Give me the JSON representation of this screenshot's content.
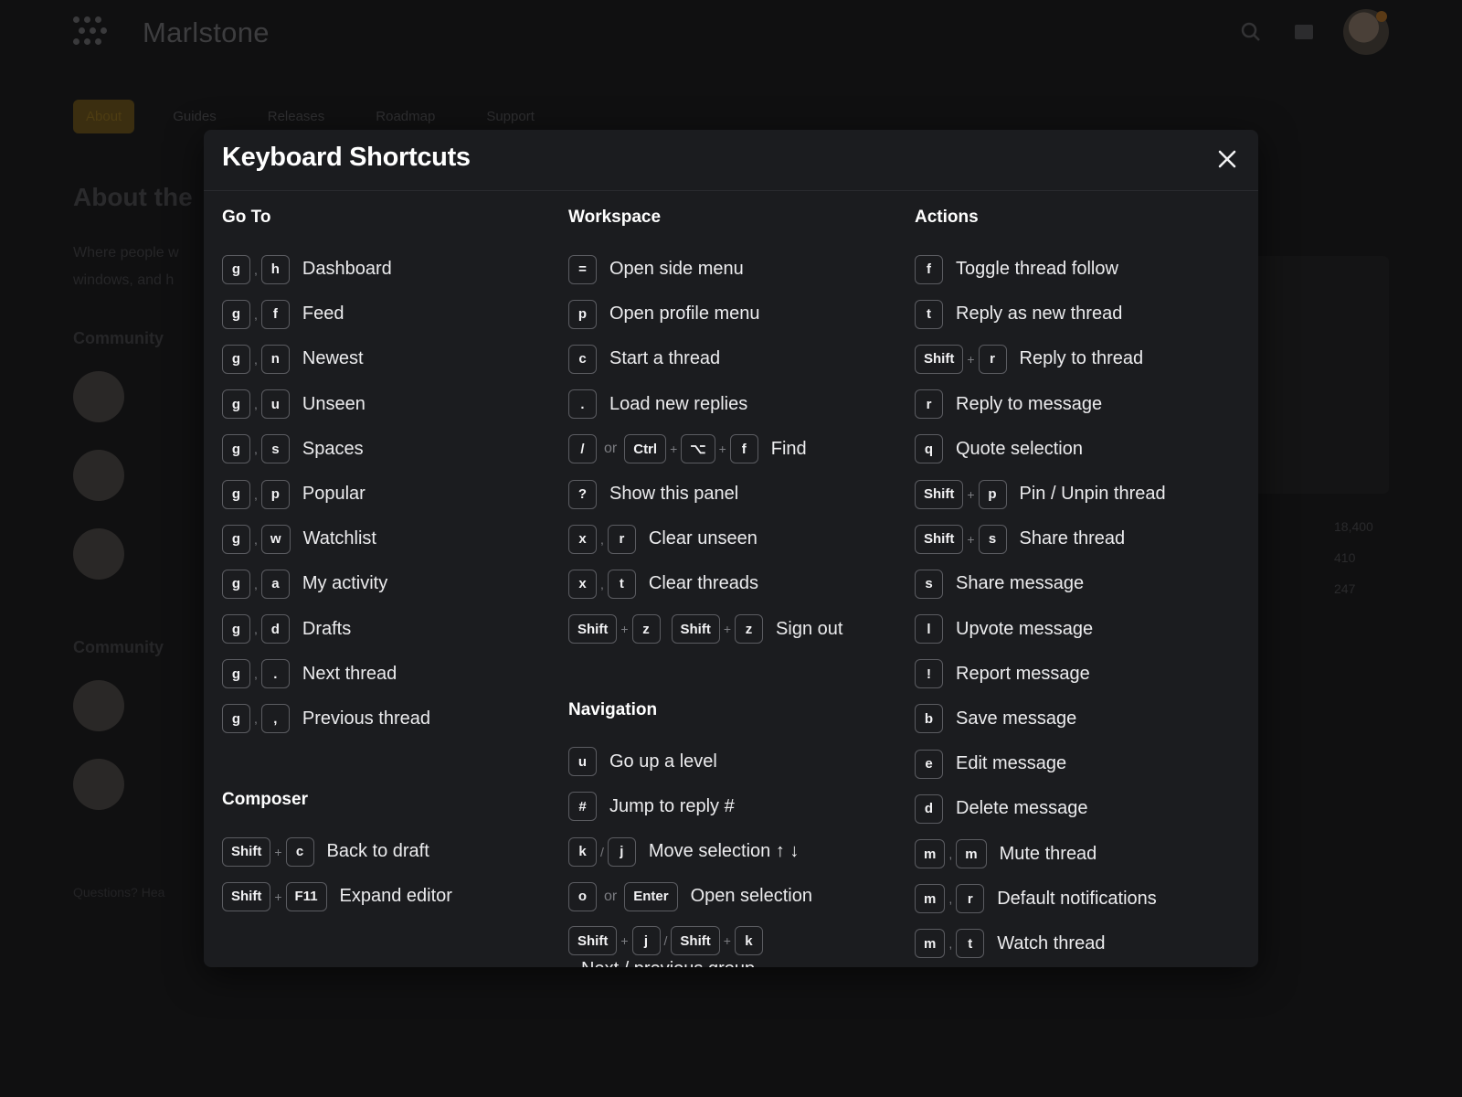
{
  "app": {
    "brand": "Marlstone",
    "accent": "#f0a91e"
  },
  "header_icons": [
    "search-icon",
    "grid-icon"
  ],
  "background": {
    "tabs": [
      "About",
      "Guides",
      "Releases",
      "Roadmap",
      "Support"
    ],
    "title": "About the",
    "description": "Where people w windows, and h",
    "sections": [
      "Community",
      "Community"
    ],
    "stats": [
      "18,400",
      "410",
      "247"
    ],
    "footer": "Questions? Hea"
  },
  "modal": {
    "title": "Keyboard Shortcuts",
    "close_icon": "close-icon",
    "columns": [
      {
        "sections": [
          {
            "title": "Go To",
            "shortcuts": [
              {
                "keys": [
                  [
                    "g"
                  ],
                  [
                    "h"
                  ]
                ],
                "joiners": [
                  ","
                ],
                "description": "Dashboard"
              },
              {
                "keys": [
                  [
                    "g"
                  ],
                  [
                    "f"
                  ]
                ],
                "joiners": [
                  ","
                ],
                "description": "Feed"
              },
              {
                "keys": [
                  [
                    "g"
                  ],
                  [
                    "n"
                  ]
                ],
                "joiners": [
                  ","
                ],
                "description": "Newest"
              },
              {
                "keys": [
                  [
                    "g"
                  ],
                  [
                    "u"
                  ]
                ],
                "joiners": [
                  ","
                ],
                "description": "Unseen"
              },
              {
                "keys": [
                  [
                    "g"
                  ],
                  [
                    "s"
                  ]
                ],
                "joiners": [
                  ","
                ],
                "description": "Spaces"
              },
              {
                "keys": [
                  [
                    "g"
                  ],
                  [
                    "p"
                  ]
                ],
                "joiners": [
                  ","
                ],
                "description": "Popular"
              },
              {
                "keys": [
                  [
                    "g"
                  ],
                  [
                    "w"
                  ]
                ],
                "joiners": [
                  ","
                ],
                "description": "Watchlist"
              },
              {
                "keys": [
                  [
                    "g"
                  ],
                  [
                    "a"
                  ]
                ],
                "joiners": [
                  ","
                ],
                "description": "My activity"
              },
              {
                "keys": [
                  [
                    "g"
                  ],
                  [
                    "d"
                  ]
                ],
                "joiners": [
                  ","
                ],
                "description": "Drafts"
              },
              {
                "keys": [
                  [
                    "g"
                  ],
                  [
                    "."
                  ]
                ],
                "joiners": [
                  ","
                ],
                "description": "Next thread"
              },
              {
                "keys": [
                  [
                    "g"
                  ],
                  [
                    ","
                  ]
                ],
                "joiners": [
                  ","
                ],
                "description": "Previous thread"
              }
            ]
          },
          {
            "title": "Composer",
            "shortcuts": [
              {
                "keys": [
                  [
                    "Shift",
                    "c"
                  ]
                ],
                "joiners": [],
                "description": "Back to draft"
              },
              {
                "keys": [
                  [
                    "Shift",
                    "F11"
                  ]
                ],
                "joiners": [],
                "description": "Expand editor"
              }
            ]
          }
        ]
      },
      {
        "sections": [
          {
            "title": "Workspace",
            "shortcuts": [
              {
                "keys": [
                  [
                    "="
                  ]
                ],
                "joiners": [],
                "description": "Open side menu"
              },
              {
                "keys": [
                  [
                    "p"
                  ]
                ],
                "joiners": [],
                "description": "Open profile menu"
              },
              {
                "keys": [
                  [
                    "c"
                  ]
                ],
                "joiners": [],
                "description": "Start a thread"
              },
              {
                "keys": [
                  [
                    "."
                  ]
                ],
                "joiners": [],
                "description": "Load new replies"
              },
              {
                "keys": [
                  [
                    "/"
                  ],
                  [
                    "Ctrl",
                    "⌥",
                    "f"
                  ]
                ],
                "joiners": [
                  "or"
                ],
                "description": "Find"
              },
              {
                "keys": [
                  [
                    "?"
                  ]
                ],
                "joiners": [],
                "description": "Show this panel"
              },
              {
                "keys": [
                  [
                    "x"
                  ],
                  [
                    "r"
                  ]
                ],
                "joiners": [
                  ","
                ],
                "description": "Clear unseen"
              },
              {
                "keys": [
                  [
                    "x"
                  ],
                  [
                    "t"
                  ]
                ],
                "joiners": [
                  ","
                ],
                "description": "Clear threads"
              },
              {
                "keys": [
                  [
                    "Shift",
                    "z"
                  ],
                  [
                    "Shift",
                    "z"
                  ]
                ],
                "joiners": [
                  ""
                ],
                "description": "Sign out"
              }
            ]
          },
          {
            "title": "Navigation",
            "shortcuts": [
              {
                "keys": [
                  [
                    "u"
                  ]
                ],
                "joiners": [],
                "description": "Go up a level"
              },
              {
                "keys": [
                  [
                    "#"
                  ]
                ],
                "joiners": [],
                "description": "Jump to reply #"
              },
              {
                "keys": [
                  [
                    "k"
                  ],
                  [
                    "j"
                  ]
                ],
                "joiners": [
                  "/"
                ],
                "description": "Move selection ↑ ↓"
              },
              {
                "keys": [
                  [
                    "o"
                  ],
                  [
                    "Enter"
                  ]
                ],
                "joiners": [
                  "or"
                ],
                "description": "Open selection"
              },
              {
                "keys": [
                  [
                    "Shift",
                    "j"
                  ],
                  [
                    "Shift",
                    "k"
                  ]
                ],
                "joiners": [
                  "/"
                ],
                "description": "Next / previous group",
                "wrap": true
              }
            ]
          }
        ]
      },
      {
        "sections": [
          {
            "title": "Actions",
            "shortcuts": [
              {
                "keys": [
                  [
                    "f"
                  ]
                ],
                "joiners": [],
                "description": "Toggle thread follow"
              },
              {
                "keys": [
                  [
                    "t"
                  ]
                ],
                "joiners": [],
                "description": "Reply as new thread"
              },
              {
                "keys": [
                  [
                    "Shift",
                    "r"
                  ]
                ],
                "joiners": [],
                "description": "Reply to thread"
              },
              {
                "keys": [
                  [
                    "r"
                  ]
                ],
                "joiners": [],
                "description": "Reply to message"
              },
              {
                "keys": [
                  [
                    "q"
                  ]
                ],
                "joiners": [],
                "description": "Quote selection"
              },
              {
                "keys": [
                  [
                    "Shift",
                    "p"
                  ]
                ],
                "joiners": [],
                "description": "Pin / Unpin thread"
              },
              {
                "keys": [
                  [
                    "Shift",
                    "s"
                  ]
                ],
                "joiners": [],
                "description": "Share thread"
              },
              {
                "keys": [
                  [
                    "s"
                  ]
                ],
                "joiners": [],
                "description": "Share message"
              },
              {
                "keys": [
                  [
                    "l"
                  ]
                ],
                "joiners": [],
                "description": "Upvote message"
              },
              {
                "keys": [
                  [
                    "!"
                  ]
                ],
                "joiners": [],
                "description": "Report message"
              },
              {
                "keys": [
                  [
                    "b"
                  ]
                ],
                "joiners": [],
                "description": "Save message"
              },
              {
                "keys": [
                  [
                    "e"
                  ]
                ],
                "joiners": [],
                "description": "Edit message"
              },
              {
                "keys": [
                  [
                    "d"
                  ]
                ],
                "joiners": [],
                "description": "Delete message"
              },
              {
                "keys": [
                  [
                    "m"
                  ],
                  [
                    "m"
                  ]
                ],
                "joiners": [
                  ","
                ],
                "description": "Mute thread"
              },
              {
                "keys": [
                  [
                    "m"
                  ],
                  [
                    "r"
                  ]
                ],
                "joiners": [
                  ","
                ],
                "description": "Default notifications"
              },
              {
                "keys": [
                  [
                    "m"
                  ],
                  [
                    "t"
                  ]
                ],
                "joiners": [
                  ","
                ],
                "description": "Watch thread"
              }
            ]
          }
        ]
      }
    ]
  }
}
